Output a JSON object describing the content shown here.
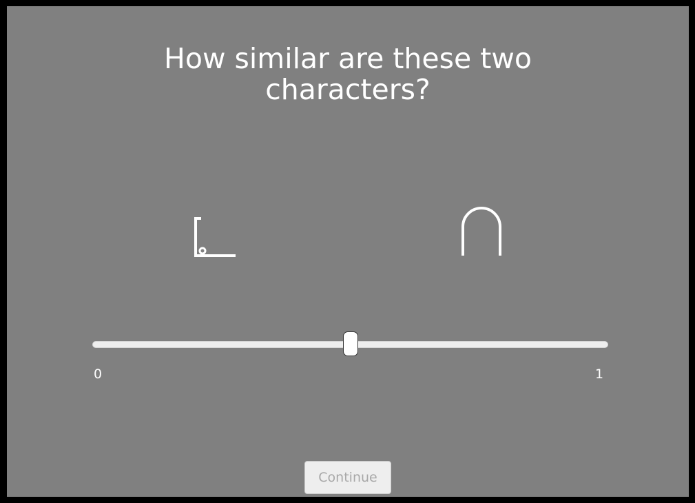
{
  "question": {
    "line1": "How similar are these two",
    "line2": "characters?"
  },
  "stimuli": {
    "left": "bracket-corner-glyph",
    "right": "cap-arch-glyph"
  },
  "slider": {
    "min_label": "0",
    "max_label": "1",
    "value_fraction": 0.5
  },
  "continue_button": {
    "label": "Continue",
    "enabled": false
  },
  "colors": {
    "background": "#808080",
    "frame": "#000000",
    "text": "#ffffff"
  }
}
